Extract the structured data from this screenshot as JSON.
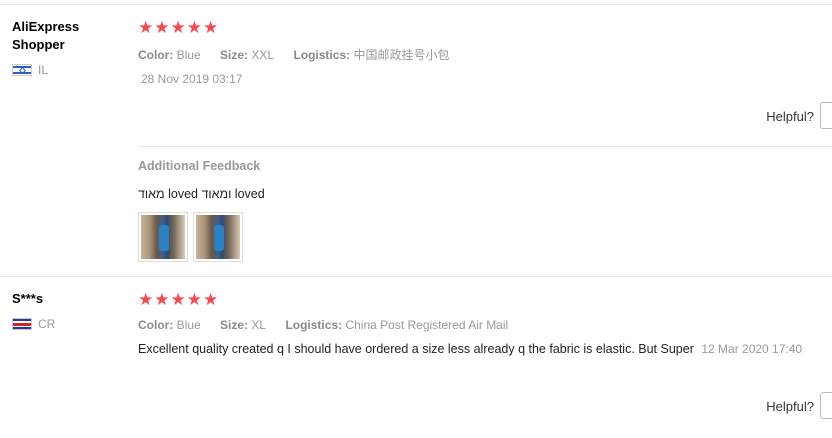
{
  "reviews": [
    {
      "user": {
        "name": "AliExpress Shopper",
        "country": "IL",
        "flag": "israel-flag-icon"
      },
      "stars": "★★★★★",
      "attrs": {
        "color_key": "Color:",
        "color_val": "Blue",
        "size_key": "Size:",
        "size_val": "XXL",
        "logistics_key": "Logistics:",
        "logistics_val": "中国邮政挂号小包"
      },
      "date": "28 Nov 2019 03:17",
      "helpful": "Helpful?",
      "additional": {
        "title": "Additional Feedback",
        "text": "מאוד loved ומאוד loved",
        "thumbs": 2
      }
    },
    {
      "user": {
        "name": "S***s",
        "country": "CR",
        "flag": "costa-rica-flag-icon"
      },
      "stars": "★★★★★",
      "attrs": {
        "color_key": "Color:",
        "color_val": "Blue",
        "size_key": "Size:",
        "size_val": "XL",
        "logistics_key": "Logistics:",
        "logistics_val": "China Post Registered Air Mail"
      },
      "text": "Excellent quality created q I should have ordered a size less already q the fabric is elastic. But Super",
      "date": "12 Mar 2020 17:40",
      "helpful": "Helpful?"
    }
  ],
  "colors": {
    "star": "#f04b53",
    "muted": "#999999",
    "divider": "#e8e8e8"
  }
}
